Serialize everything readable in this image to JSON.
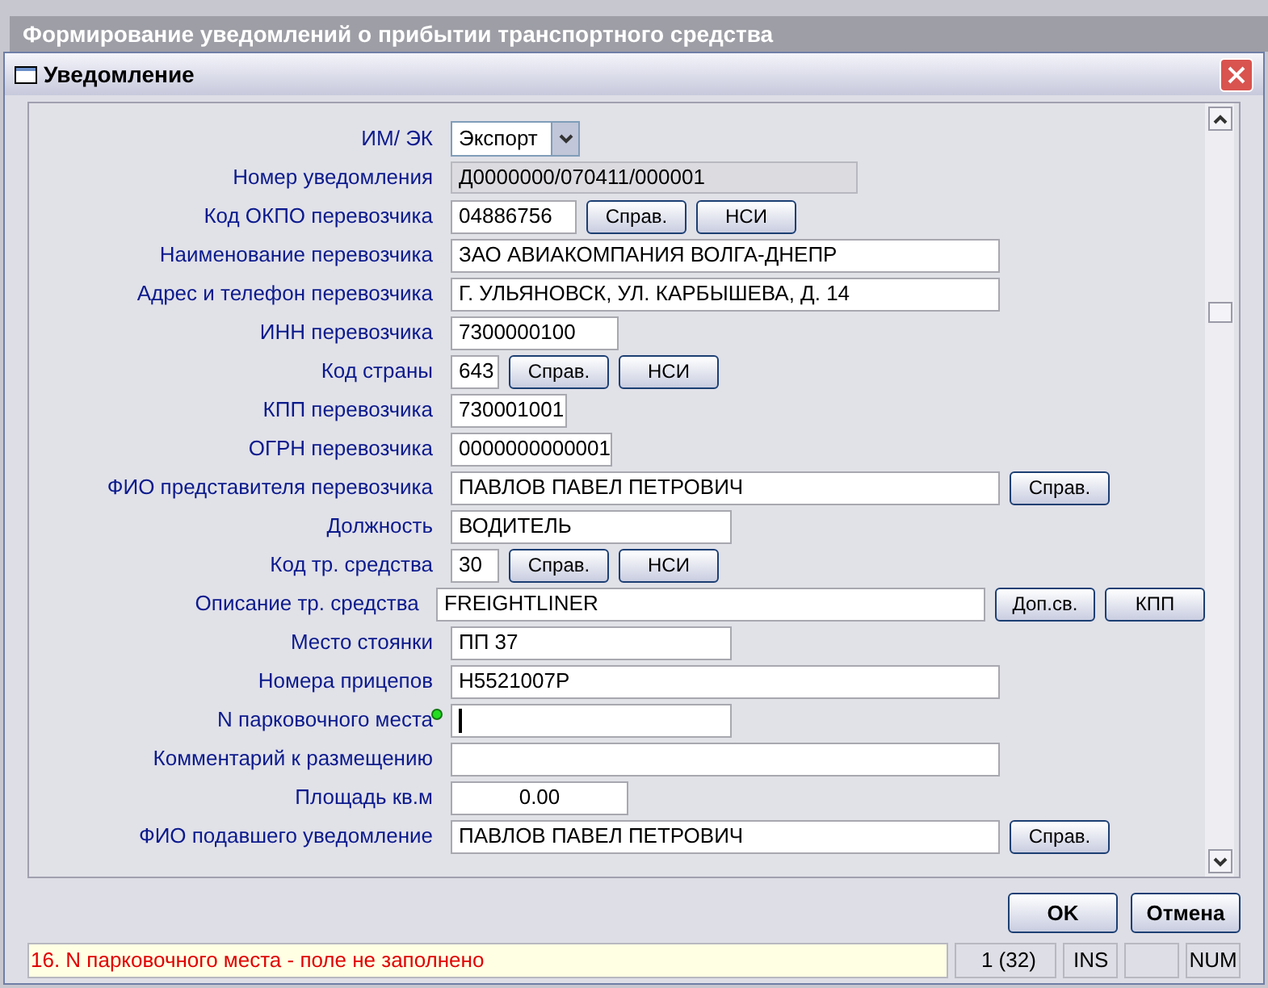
{
  "app_title": "Формирование уведомлений о прибытии транспортного средства",
  "dialog": {
    "title": "Уведомление"
  },
  "form": {
    "rows": [
      {
        "label": "ИМ/ ЭК",
        "kind": "select",
        "value": "Экспорт",
        "buttons": []
      },
      {
        "label": "Номер уведомления",
        "kind": "readonly",
        "value": "Д0000000/070411/000001",
        "buttons": []
      },
      {
        "label": "Код ОКПО перевозчика",
        "kind": "text",
        "value": "04886756",
        "buttons": [
          "Справ.",
          "НСИ"
        ]
      },
      {
        "label": "Наименование перевозчика",
        "kind": "text",
        "value": "ЗАО АВИАКОМПАНИЯ ВОЛГА-ДНЕПР",
        "buttons": []
      },
      {
        "label": "Адрес и телефон перевозчика",
        "kind": "text",
        "value": "Г. УЛЬЯНОВСК, УЛ. КАРБЫШЕВА, Д. 14",
        "buttons": []
      },
      {
        "label": "ИНН перевозчика",
        "kind": "text",
        "value": "7300000100",
        "buttons": []
      },
      {
        "label": "Код страны",
        "kind": "text",
        "value": "643",
        "buttons": [
          "Справ.",
          "НСИ"
        ]
      },
      {
        "label": "КПП перевозчика",
        "kind": "text",
        "value": "730001001",
        "buttons": []
      },
      {
        "label": "ОГРН перевозчика",
        "kind": "text",
        "value": "0000000000001",
        "buttons": []
      },
      {
        "label": "ФИО представителя перевозчика",
        "kind": "text",
        "value": "ПАВЛОВ ПАВЕЛ ПЕТРОВИЧ",
        "buttons": [
          "Справ."
        ]
      },
      {
        "label": "Должность",
        "kind": "text",
        "value": "ВОДИТЕЛЬ",
        "buttons": []
      },
      {
        "label": "Код тр. средства",
        "kind": "text",
        "value": "30",
        "buttons": [
          "Справ.",
          "НСИ"
        ]
      },
      {
        "label": "Описание тр. средства",
        "kind": "text",
        "value": "FREIGHTLINER",
        "buttons": [
          "Доп.св.",
          "КПП"
        ]
      },
      {
        "label": "Место стоянки",
        "kind": "text",
        "value": "ПП 37",
        "buttons": []
      },
      {
        "label": "Номера прицепов",
        "kind": "text",
        "value": "Н5521007Р",
        "buttons": []
      },
      {
        "label": "N парковочного места",
        "kind": "text",
        "value": "",
        "focused": true,
        "buttons": []
      },
      {
        "label": "Комментарий к размещению",
        "kind": "text",
        "value": "",
        "buttons": []
      },
      {
        "label": "Площадь кв.м",
        "kind": "number",
        "value": "0.00",
        "buttons": []
      },
      {
        "label": "ФИО подавшего уведомление",
        "kind": "text",
        "value": "ПАВЛОВ ПАВЕЛ ПЕТРОВИЧ",
        "buttons": [
          "Справ."
        ]
      }
    ]
  },
  "buttons": [
    {
      "label": "OK"
    },
    {
      "label": "Отмена"
    }
  ],
  "status_bar": {
    "message": "16. N парковочного места - поле не заполнено",
    "cells": [
      "1 (32)",
      "INS",
      "",
      "NUM"
    ]
  }
}
